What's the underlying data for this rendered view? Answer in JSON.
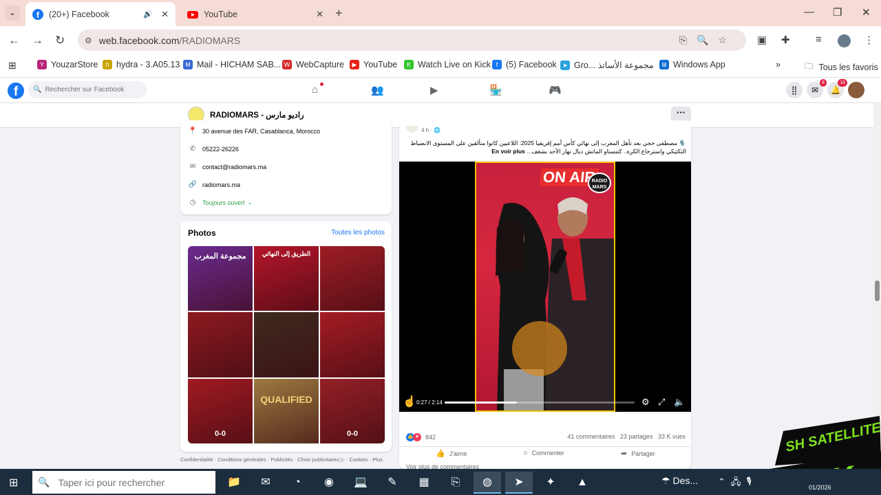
{
  "browser": {
    "tabs": [
      {
        "title": "(20+) Facebook",
        "icon": "facebook-icon",
        "active": true,
        "audio": true
      },
      {
        "title": "YouTube",
        "icon": "youtube-icon",
        "active": false
      }
    ],
    "url_domain": "web.facebook.com",
    "url_path": "/RADIOMARS",
    "bookmarks": [
      {
        "label": "YouzarStore",
        "color": "#b8237a",
        "letter": "Y"
      },
      {
        "label": "hydra - 3.A05.13",
        "color": "#c9a400",
        "letter": "h"
      },
      {
        "label": "Mail - HICHAM SAB...",
        "color": "#3568d4",
        "letter": "M"
      },
      {
        "label": "WebCapture",
        "color": "#d62b2b",
        "letter": "W"
      },
      {
        "label": "YouTube",
        "color": "#e62117",
        "letter": "▶"
      },
      {
        "label": "Watch Live on Kick",
        "color": "#32c62e",
        "letter": "K"
      },
      {
        "label": "(5) Facebook",
        "color": "#1877f2",
        "letter": "f"
      },
      {
        "label": "Gro... مجموعة الأساتذ",
        "color": "#2aa3dc",
        "letter": "➤"
      },
      {
        "label": "Windows App",
        "color": "#0a6bd1",
        "letter": "⊞"
      }
    ],
    "bookmarks_more": "»",
    "all_bookmarks": "Tous les favoris"
  },
  "facebook": {
    "search_placeholder": "Rechercher sur Facebook",
    "messenger_badge": "8",
    "notif_badge": "16",
    "page_name": "RADIOMARS - راديو مارس",
    "more": "···",
    "info": {
      "address": "30 avenue des FAR, Casablanca, Morocco",
      "phone": "05222-26226",
      "email": "contact@radiomars.ma",
      "website": "radiomars.ma",
      "hours": "Toujours ouvert"
    },
    "photos": {
      "title": "Photos",
      "see_all": "Toutes les photos",
      "tiles": [
        {
          "text": "مجموعة المغرب",
          "bg": "#6a2a8f"
        },
        {
          "text": "الطريق إلى النهائي",
          "bg": "#b5162a"
        },
        {
          "text": "",
          "bg": "#9e1d25"
        },
        {
          "text": "",
          "bg": "#8c1a20"
        },
        {
          "text": "",
          "bg": "#3f2a20"
        },
        {
          "text": "",
          "bg": "#a51c24"
        },
        {
          "text": "0-0",
          "bg": "#a01a22"
        },
        {
          "text": "QUALIFIED",
          "bg": "#9c7a40"
        },
        {
          "text": "0-0",
          "bg": "#932026"
        }
      ]
    },
    "footer": "Confidentialité · Conditions générales · Publicités · Choix publicitaires ▷ · Cookies · Plus"
  },
  "post": {
    "time": "4 h · 🌐",
    "text": "🎙️ مصطفى حجي بعد تأهل المغرب إلى نهائي كأس أمم إفريقيا 2025: اللاعبين كانوا متألقين على المستوى الانضباط التكتيكي واسترجاع الكرة.. كتنستاو الماتش ديال نهار الأحد بشغف...",
    "see_more": "En voir plus",
    "video": {
      "on_air": "ON AIR",
      "logo": "RADIO MARS",
      "time": "0:27 / 2:14",
      "progress": 0.38
    },
    "reactions": "842",
    "comments": "41 commentaires",
    "shares": "23 partages",
    "views": "33 K vues",
    "like": "J'aime",
    "comment": "Commenter",
    "share": "Partager",
    "more_comments": "Voir plus de commentaires"
  },
  "watermark": {
    "line1": "SH SATELLITE",
    "line2": "KICK"
  },
  "taskbar": {
    "search_placeholder": "Taper ici pour rechercher",
    "weather": "Des...",
    "date": "01/2026"
  }
}
